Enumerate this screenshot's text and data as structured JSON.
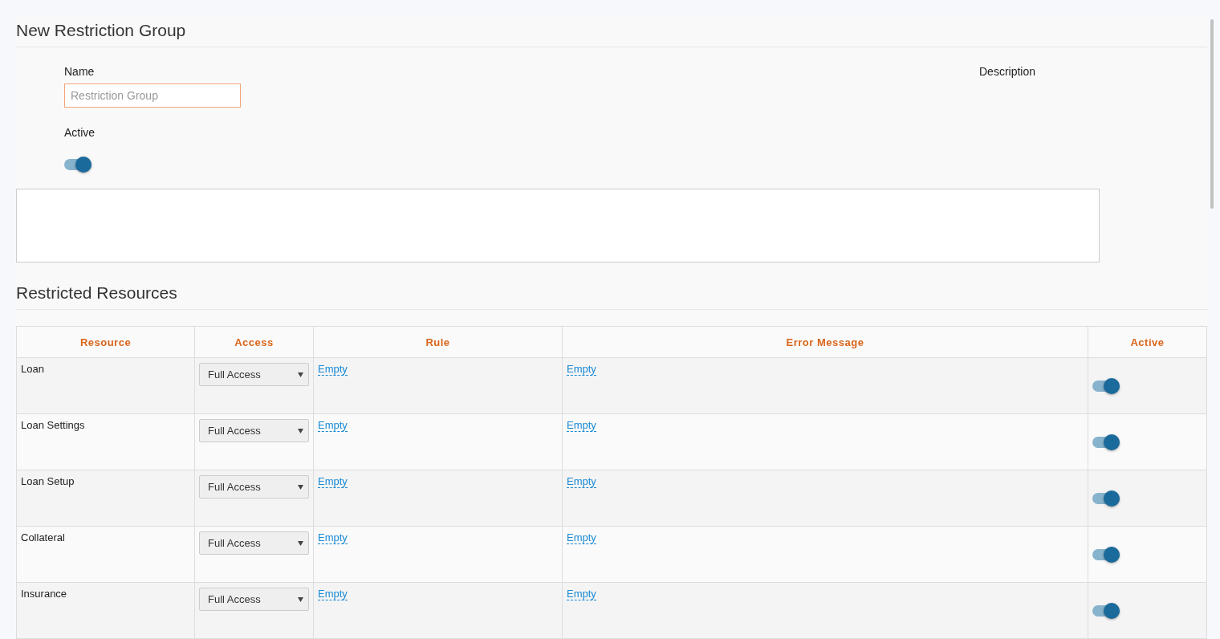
{
  "title": "New Restriction Group",
  "form": {
    "name_label": "Name",
    "name_placeholder": "Restriction Group",
    "description_label": "Description",
    "active_label": "Active",
    "active_on": true
  },
  "section_title": "Restricted Resources",
  "table": {
    "columns": [
      "Resource",
      "Access",
      "Rule",
      "Error Message",
      "Active"
    ],
    "rows": [
      {
        "resource": "Loan",
        "access": "Full Access",
        "rule": "Empty",
        "error_message": "Empty",
        "active": true
      },
      {
        "resource": "Loan Settings",
        "access": "Full Access",
        "rule": "Empty",
        "error_message": "Empty",
        "active": true
      },
      {
        "resource": "Loan Setup",
        "access": "Full Access",
        "rule": "Empty",
        "error_message": "Empty",
        "active": true
      },
      {
        "resource": "Collateral",
        "access": "Full Access",
        "rule": "Empty",
        "error_message": "Empty",
        "active": true
      },
      {
        "resource": "Insurance",
        "access": "Full Access",
        "rule": "Empty",
        "error_message": "Empty",
        "active": true
      }
    ]
  }
}
